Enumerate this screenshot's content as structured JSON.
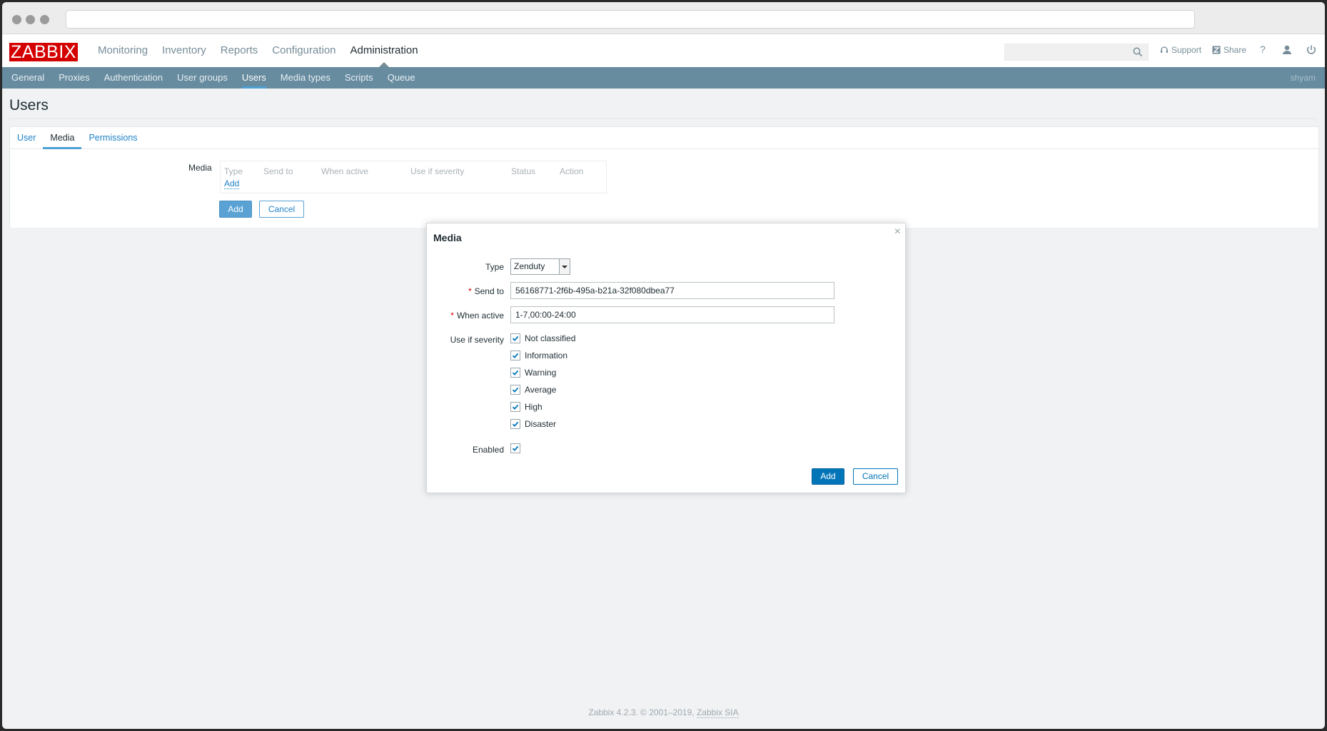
{
  "header": {
    "logo": "ZABBIX",
    "nav": [
      "Monitoring",
      "Inventory",
      "Reports",
      "Configuration",
      "Administration"
    ],
    "active_nav": "Administration",
    "support": "Support",
    "share": "Share",
    "help": "?"
  },
  "subnav": {
    "items": [
      "General",
      "Proxies",
      "Authentication",
      "User groups",
      "Users",
      "Media types",
      "Scripts",
      "Queue"
    ],
    "active": "Users",
    "username": "shyam"
  },
  "page": {
    "title": "Users",
    "tabs": [
      "User",
      "Media",
      "Permissions"
    ],
    "active_tab": "Media",
    "media_label": "Media",
    "media_columns": [
      "Type",
      "Send to",
      "When active",
      "Use if severity",
      "Status",
      "Action"
    ],
    "media_add_link": "Add",
    "add_button": "Add",
    "cancel_button": "Cancel"
  },
  "dialog": {
    "title": "Media",
    "close": "×",
    "type_label": "Type",
    "type_value": "Zenduty",
    "send_to_label": "Send to",
    "send_to_value": "56168771-2f6b-495a-b21a-32f080dbea77",
    "when_active_label": "When active",
    "when_active_value": "1-7,00:00-24:00",
    "severity_label": "Use if severity",
    "severities": [
      "Not classified",
      "Information",
      "Warning",
      "Average",
      "High",
      "Disaster"
    ],
    "enabled_label": "Enabled",
    "add_button": "Add",
    "cancel_button": "Cancel"
  },
  "footer": {
    "text": "Zabbix 4.2.3. © 2001–2019, ",
    "link": "Zabbix SIA"
  },
  "colors": {
    "brand_red": "#d40000",
    "subnav_bg": "#678b9f",
    "accent_blue": "#1f83c7",
    "button_blue": "#0275b8"
  },
  "icons": {
    "search": "search-icon",
    "support": "headset-icon",
    "share": "share-icon",
    "user": "user-icon",
    "logout": "power-icon",
    "checkbox": "checkmark-icon"
  }
}
